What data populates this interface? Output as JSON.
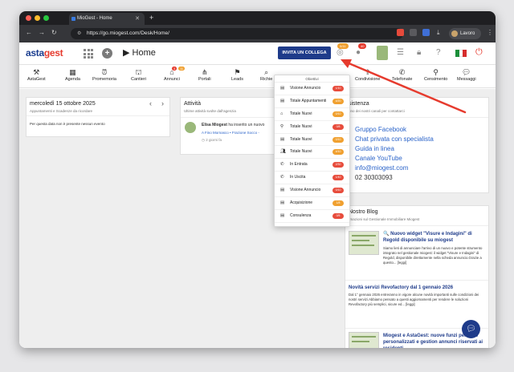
{
  "browser": {
    "tab_title": "MioGest - Home",
    "url": "https://go.miogest.com/Desk/Home/",
    "profile_label": "Lavoro"
  },
  "header": {
    "logo_main": "asta",
    "logo_accent": "gest",
    "page_title": "Home",
    "invite_label": "INVITA UN COLLEGA",
    "badge_objectives": "0/11",
    "badge_notifications": "40"
  },
  "toolbar": [
    {
      "label": "AstaGest",
      "icon": "gavel-icon"
    },
    {
      "label": "Agenda",
      "icon": "calendar-icon"
    },
    {
      "label": "Promemoria",
      "icon": "alarm-icon"
    },
    {
      "label": "Cantieri",
      "icon": "crane-icon"
    },
    {
      "label": "Annunci",
      "icon": "house-icon"
    },
    {
      "label": "Portali",
      "icon": "network-icon"
    },
    {
      "label": "Leads",
      "icon": "flag-icon"
    },
    {
      "label": "Richie",
      "icon": "search-icon"
    },
    {
      "label": "Condivisione",
      "icon": "share-icon"
    },
    {
      "label": "Telefonate",
      "icon": "phone-icon"
    },
    {
      "label": "Censimento",
      "icon": "pin-icon"
    },
    {
      "label": "Messaggi",
      "icon": "chat-icon"
    }
  ],
  "toolbar_badges": {
    "annunci_a": "3",
    "annunci_b": "11"
  },
  "agenda_card": {
    "date": "mercoledì 15 ottobre 2025",
    "subtitle": "Appuntamenti e Scadenze da ricordare",
    "empty_text": "Per questa data non è presente nessun evento"
  },
  "activity_card": {
    "title": "Attività",
    "subtitle": "Ultime attività svolte dall'agenzia",
    "user": "Elisa Miogest",
    "action": "ha inserito un nuovo",
    "location": "A Fino Mornasco • Frazione Socco -",
    "time": "2 giorni fa"
  },
  "assist_card": {
    "title": "sistenza",
    "subtitle": "uno dei nostri canali per contattarci",
    "links": [
      "Gruppo Facebook",
      "Chat privata con specialista",
      "Guida in linea",
      "Canale YouTube",
      "info@miogest.com",
      "02 30303093"
    ]
  },
  "blog_card": {
    "title": "Nostro Blog",
    "subtitle": "rmazioni sul Gestionale Immobiliare Miogest",
    "posts": [
      {
        "title": "🔍 Nuovo widget \"Visure e Indagini\" di Regold disponibile su miogest",
        "text": "Siamo lieti di annunciare l'arrivo di un nuovo e potente strumento integrato nel gestionale miogest: il widget \"Visure e Indagini\" di Regold, disponibile direttamente nella scheda annuncio.Grazie a questo... [leggi]"
      },
      {
        "title": "Novità servizi Revofactory dal 1 gennaio 2026",
        "text": "Dal 1° gennaio 2026 entreranno in vigore alcune novità importanti sulle condizioni dei nostri servizi.Abbiamo pensato a questi aggiornamenti per rendere le soluzioni Revofactory più semplici, sicure ed... [leggi]"
      },
      {
        "title": "Miogest e AstaGest: nuove funzi per SMS personalizzati e gestion annunci riservati ai residenti",
        "text": ""
      }
    ]
  },
  "objectives_dropdown": {
    "header": "Obiettivi",
    "items": [
      {
        "label": "Visione Annuncio",
        "badge": "1/10",
        "color": "#e74c3c",
        "icon": "list-icon"
      },
      {
        "label": "Totale Appuntamenti",
        "badge": "4/20",
        "color": "#f0a030",
        "icon": "list-icon"
      },
      {
        "label": "Totale Nuovi",
        "badge": "0/10",
        "color": "#f0a030",
        "icon": "house-icon"
      },
      {
        "label": "Totale Nuovi",
        "badge": "0/8",
        "color": "#e74c3c",
        "icon": "pin-icon"
      },
      {
        "label": "Totale Nuovi",
        "badge": "0/10",
        "color": "#f0a030",
        "icon": "list-icon"
      },
      {
        "label": "Totale Nuovi",
        "badge": "4/10",
        "color": "#f0a030",
        "icon": "users-icon"
      },
      {
        "label": "In Entrata",
        "badge": "2/30",
        "color": "#e74c3c",
        "icon": "phone-in-icon"
      },
      {
        "label": "In Uscita",
        "badge": "1/40",
        "color": "#e74c3c",
        "icon": "phone-out-icon"
      },
      {
        "label": "Visione Annuncio",
        "badge": "0/10",
        "color": "#e74c3c",
        "icon": "list-icon"
      },
      {
        "label": "Acquisizione",
        "badge": "1/8",
        "color": "#f0a030",
        "icon": "list-icon"
      },
      {
        "label": "Consulenza",
        "badge": "0/5",
        "color": "#e74c3c",
        "icon": "list-icon"
      }
    ]
  },
  "colors": {
    "brand": "#1e3b8a",
    "accent": "#e63b2e",
    "link": "#2a63c9"
  }
}
